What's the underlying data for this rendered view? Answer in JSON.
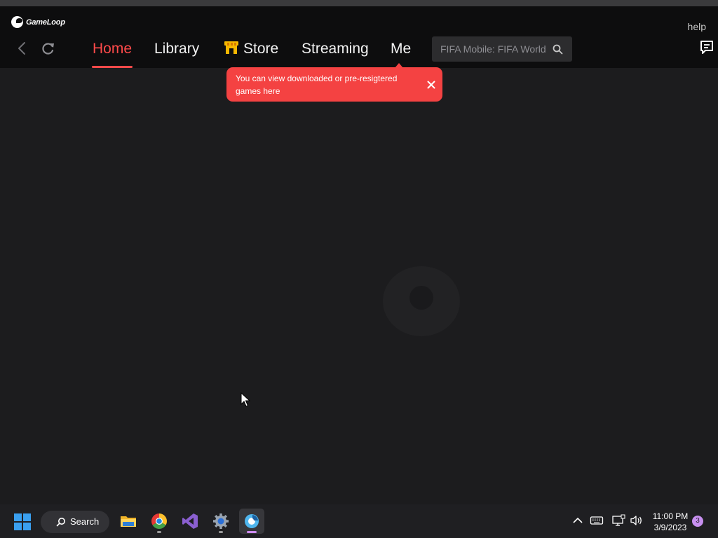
{
  "app": {
    "logo_text": "GameLoop",
    "help_label": "help"
  },
  "nav": {
    "tabs": [
      {
        "label": "Home",
        "active": true
      },
      {
        "label": "Library"
      },
      {
        "label": "Store",
        "icon": "store-icon"
      },
      {
        "label": "Streaming"
      },
      {
        "label": "Me"
      }
    ],
    "search": {
      "placeholder": "FIFA Mobile: FIFA World Cup",
      "icon": "search-icon"
    }
  },
  "tooltip": {
    "text": "You can view downloaded or pre-resigtered games here",
    "close_icon": "close-icon"
  },
  "taskbar": {
    "search_label": "Search",
    "apps": [
      "file-explorer",
      "chrome",
      "visual-studio",
      "settings",
      "gameloop"
    ],
    "clock": {
      "time": "11:00 PM",
      "date": "3/9/2023"
    },
    "notification_count": "3"
  },
  "colors": {
    "accent": "#ff4a4a",
    "tooltip_bg": "#f44242",
    "background": "#1c1c1e",
    "header_bg": "#0d0d0e"
  }
}
